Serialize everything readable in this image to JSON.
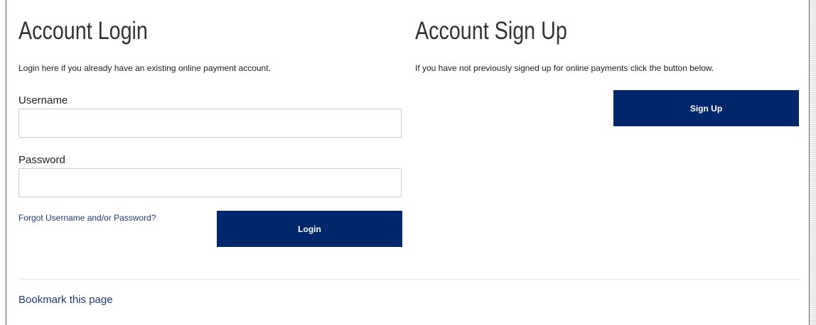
{
  "login": {
    "title": "Account Login",
    "description": "Login here if you already have an existing online payment account.",
    "username_label": "Username",
    "username_value": "",
    "password_label": "Password",
    "password_value": "",
    "forgot_link": "Forgot Username and/or Password?",
    "login_button": "Login"
  },
  "signup": {
    "title": "Account Sign Up",
    "description": "If you have not previously signed up for online payments click the button below.",
    "signup_button": "Sign Up"
  },
  "footer": {
    "bookmark_link": "Bookmark this page"
  },
  "colors": {
    "button_bg": "#00276c",
    "link": "#1f3a7a"
  }
}
